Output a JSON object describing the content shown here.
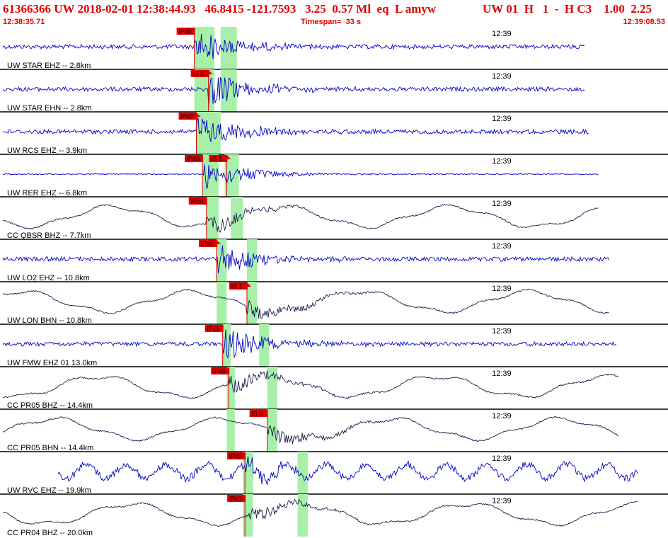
{
  "header": {
    "event_line": "61366366 UW 2018-02-01 12:38:44.93   46.8415 -121.7593   3.25  0.57 Ml  eq  L amyw",
    "right_line": "UW 01  H   1  -  H C3    1.00  2.25",
    "start_time": "12:38:35.71",
    "timespan": "Timespan=  33 s",
    "end_time": "12:39:08.53"
  },
  "colors": {
    "header_red": "#e00000",
    "pick_red": "#e00000",
    "pick_window_green": "#a8f0a8",
    "trace_blue": "#0000c8",
    "trace_navy": "#1a1a4a",
    "divider": "#000000"
  },
  "chart_data": {
    "type": "line",
    "x_unit": "s since 12:38:35.71",
    "x_range": [
      0,
      33
    ],
    "minute_marker": {
      "label": "12:39",
      "t": 24.3
    },
    "channels": [
      {
        "label": "UW STAR EHZ -- 2.8km",
        "color": "blue",
        "style": "noise",
        "end": 28.9,
        "picks": [
          {
            "label": "iPc0",
            "t": 9.6,
            "arrow": false
          }
        ],
        "windows": [
          [
            9.6,
            10.6
          ],
          [
            10.9,
            11.7
          ]
        ]
      },
      {
        "label": "UW STAR EHN -- 2.8km",
        "color": "blue",
        "style": "noise",
        "end": 28.9,
        "picks": [
          {
            "label": "iS 0",
            "t": 10.3,
            "arrow": true
          }
        ],
        "windows": [
          [
            9.6,
            10.6
          ],
          [
            10.9,
            11.7
          ]
        ]
      },
      {
        "label": "UW RCS EHZ -- 3.9km",
        "color": "blue",
        "style": "noise",
        "end": 29.1,
        "picks": [
          {
            "label": "iPc0",
            "t": 9.7,
            "arrow": true
          }
        ],
        "windows": [
          [
            9.7,
            10.9
          ]
        ]
      },
      {
        "label": "UW RER EHZ -- 6.8km",
        "color": "blue",
        "style": "quiet",
        "end": 29.6,
        "picks": [
          {
            "label": "iPd0",
            "t": 10.0,
            "arrow": false
          },
          {
            "label": "iS 1",
            "t": 11.2,
            "arrow": true
          }
        ],
        "windows": [
          [
            10.0,
            10.8
          ],
          [
            11.1,
            11.8
          ]
        ]
      },
      {
        "label": "CC QBSR BHZ -- 7.7km",
        "color": "navy",
        "style": "long",
        "end": 29.6,
        "picks": [
          {
            "label": "iPc0",
            "t": 10.2,
            "arrow": false
          }
        ],
        "windows": [
          [
            10.2,
            10.8
          ],
          [
            11.4,
            12.0
          ]
        ]
      },
      {
        "label": "UW LO2 EHZ -- 10.8km",
        "color": "blue",
        "style": "noise",
        "end": 30.1,
        "picks": [
          {
            "label": "iPd0",
            "t": 10.7,
            "arrow": true
          }
        ],
        "windows": [
          [
            10.7,
            11.2
          ],
          [
            12.2,
            12.7
          ]
        ]
      },
      {
        "label": "UW LON BHN -- 10.8km",
        "color": "navy",
        "style": "long",
        "end": 30.1,
        "picks": [
          {
            "label": "iS 1",
            "t": 12.2,
            "arrow": true
          }
        ],
        "windows": [
          [
            10.7,
            11.2
          ],
          [
            12.2,
            12.7
          ]
        ]
      },
      {
        "label": "UW FMW EHZ 01 13.0km",
        "color": "blue",
        "style": "noise",
        "end": 30.5,
        "picks": [
          {
            "label": "iPc1",
            "t": 11.0,
            "arrow": false
          }
        ],
        "windows": [
          [
            11.0,
            11.4
          ],
          [
            12.8,
            13.3
          ]
        ]
      },
      {
        "label": "CC PR05 BHZ -- 14.4km",
        "color": "navy",
        "style": "long",
        "end": 30.6,
        "picks": [
          {
            "label": "iPc0",
            "t": 11.3,
            "arrow": false
          }
        ],
        "windows": [
          [
            11.2,
            11.6
          ],
          [
            13.2,
            13.7
          ]
        ]
      },
      {
        "label": "CC PR05 BHN -- 14.4km",
        "color": "navy",
        "style": "long",
        "end": 30.6,
        "picks": [
          {
            "label": "iS 0",
            "t": 13.2,
            "arrow": false
          }
        ],
        "windows": [
          [
            11.2,
            11.6
          ],
          [
            13.2,
            13.7
          ]
        ]
      },
      {
        "label": "UW RVC EHZ -- 19.9km",
        "color": "blue",
        "style": "wiggle",
        "end": 31.5,
        "picks": [
          {
            "label": "iPc0",
            "t": 12.1,
            "arrow": false
          }
        ],
        "windows": [
          [
            12.0,
            12.5
          ],
          [
            14.7,
            15.2
          ]
        ]
      },
      {
        "label": "CC PR04 BHZ -- 20.0km",
        "color": "navy",
        "style": "long",
        "end": 31.5,
        "picks": [
          {
            "label": "iPc0",
            "t": 12.1,
            "arrow": false
          }
        ],
        "windows": [
          [
            12.0,
            12.5
          ],
          [
            14.7,
            15.2
          ]
        ]
      }
    ]
  }
}
